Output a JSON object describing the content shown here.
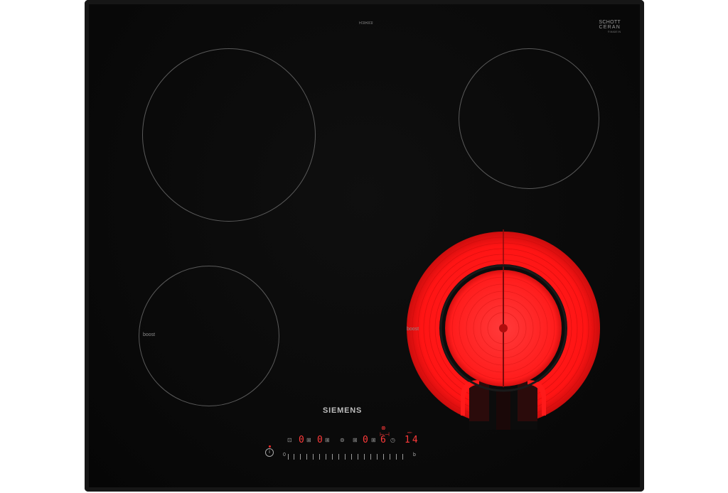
{
  "product": {
    "top_code": "8384834",
    "glass_brand_line1": "SCHOTT",
    "glass_brand_line2": "CERAN",
    "glass_brand_line3": "® MADE IN",
    "brand": "SIEMENS"
  },
  "zones": {
    "boost_label_left": "boost",
    "boost_label_right": "boost",
    "active_zone_color": "#ff1a1a"
  },
  "controls": {
    "display_1": "0",
    "display_2": "0",
    "display_3": "0",
    "display_active": "6",
    "timer_value": "14",
    "timer_small_label": "min",
    "slider_start": "0",
    "slider_end": "b",
    "info_icon": "i"
  }
}
